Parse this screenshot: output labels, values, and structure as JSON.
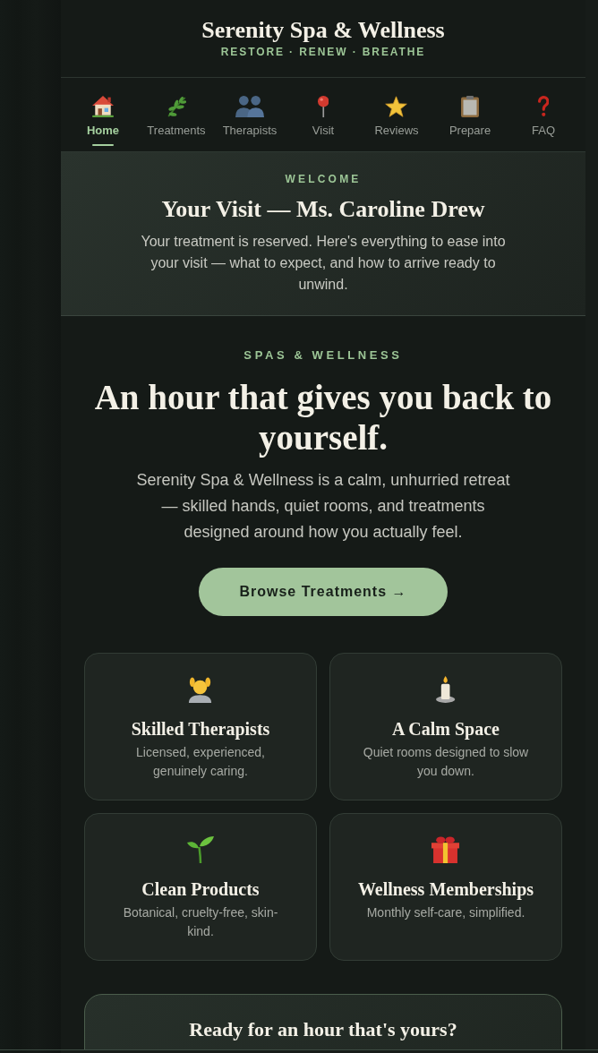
{
  "header": {
    "title": "Serenity Spa & Wellness",
    "tagline": "RESTORE · RENEW · BREATHE"
  },
  "nav": {
    "items": [
      {
        "label": "Home",
        "selected": true
      },
      {
        "label": "Treatments",
        "selected": false
      },
      {
        "label": "Therapists",
        "selected": false
      },
      {
        "label": "Visit",
        "selected": false
      },
      {
        "label": "Reviews",
        "selected": false
      },
      {
        "label": "Prepare",
        "selected": false
      },
      {
        "label": "FAQ",
        "selected": false
      }
    ]
  },
  "welcome": {
    "eyebrow": "WELCOME",
    "title": "Your Visit — Ms. Caroline Drew",
    "text": "Your treatment is reserved. Here's everything to ease into your visit — what to expect, and how to arrive ready to unwind."
  },
  "hero": {
    "eyebrow": "SPAS & WELLNESS",
    "title": "An hour that gives you back to yourself.",
    "text": "Serenity Spa & Wellness is a calm, unhurried retreat — skilled hands, quiet rooms, and treatments designed around how you actually feel.",
    "button": "Browse Treatments →"
  },
  "features": [
    {
      "title": "Skilled Therapists",
      "text": "Licensed, experienced, genuinely caring."
    },
    {
      "title": "A Calm Space",
      "text": "Quiet rooms designed to slow you down."
    },
    {
      "title": "Clean Products",
      "text": "Botanical, cruelty-free, skin-kind."
    },
    {
      "title": "Wellness Memberships",
      "text": "Monthly self-care, simplified."
    }
  ],
  "cta": {
    "title": "Ready for an hour that's yours?"
  }
}
